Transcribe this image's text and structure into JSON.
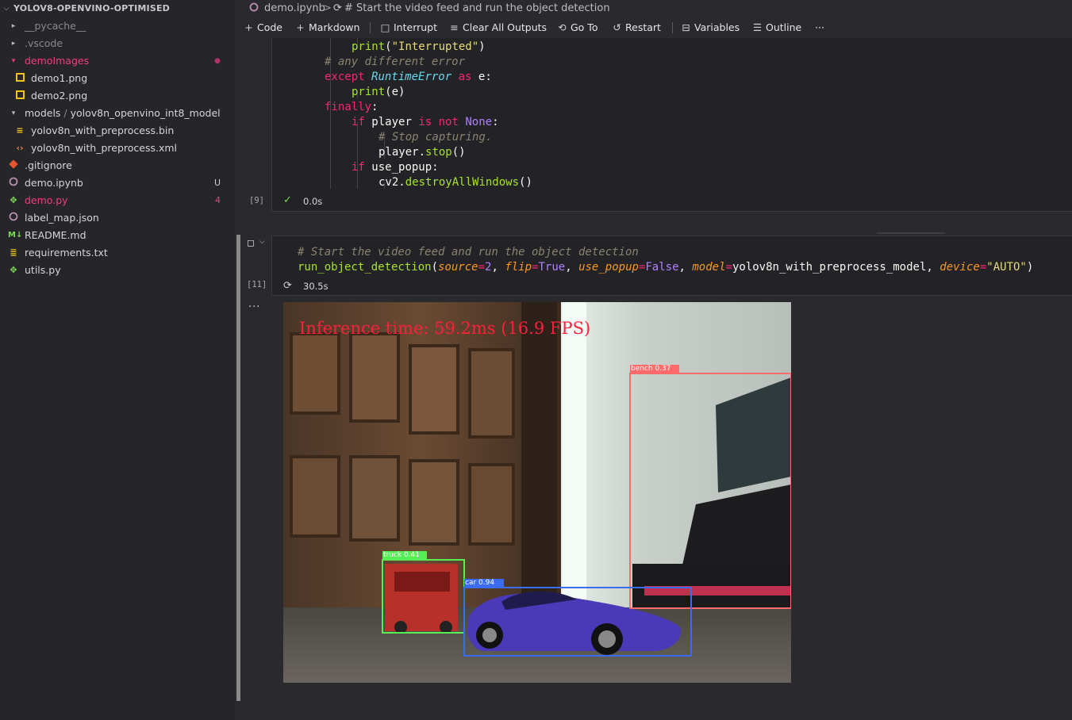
{
  "sidebar": {
    "root": "YOLOV8-OPENVINO-OPTIMISED",
    "items": [
      {
        "label": "__pycache__",
        "icon": "chevron-right-icon",
        "color": "#8a8a8a"
      },
      {
        "label": ".vscode",
        "icon": "chevron-right-icon",
        "color": "#8a8a8a"
      },
      {
        "label": "demoImages",
        "icon": "chevron-down-icon",
        "color": "#e8427c",
        "badge": "●"
      },
      {
        "label": "demo1.png",
        "icon": "image-file-icon",
        "color": "#d6d6d6"
      },
      {
        "label": "demo2.png",
        "icon": "image-file-icon",
        "color": "#d6d6d6"
      },
      {
        "label_a": "models",
        "label_sep": " / ",
        "label_b": "yolov8n_openvino_int8_model",
        "icon": "chevron-down-icon",
        "color": "#d6d6d6"
      },
      {
        "label": "yolov8n_with_preprocess.bin",
        "icon": "binary-file-icon",
        "color": "#d6d6d6"
      },
      {
        "label": "yolov8n_with_preprocess.xml",
        "icon": "xml-file-icon",
        "color": "#d6d6d6"
      },
      {
        "label": ".gitignore",
        "icon": "git-icon",
        "color": "#d6d6d6"
      },
      {
        "label": "demo.ipynb",
        "icon": "jupyter-icon",
        "color": "#d6d6d6",
        "badge": "U"
      },
      {
        "label": "demo.py",
        "icon": "python-icon",
        "color": "#e8427c",
        "badge": "4"
      },
      {
        "label": "label_map.json",
        "icon": "json-icon",
        "color": "#d6d6d6"
      },
      {
        "label": "README.md",
        "icon": "markdown-icon",
        "color": "#d6d6d6"
      },
      {
        "label": "requirements.txt",
        "icon": "text-file-icon",
        "color": "#d6d6d6"
      },
      {
        "label": "utils.py",
        "icon": "python-icon",
        "color": "#d6d6d6"
      }
    ]
  },
  "breadcrumb": {
    "file": "demo.ipynb",
    "sep": ">",
    "cell": "# Start the video feed and run the object detection"
  },
  "toolbar": {
    "code": "Code",
    "markdown": "Markdown",
    "interrupt": "Interrupt",
    "clear_outputs": "Clear All Outputs",
    "goto": "Go To",
    "restart": "Restart",
    "variables": "Variables",
    "outline": "Outline",
    "more": "···"
  },
  "cell9": {
    "exec_count": "[9]",
    "status": "0.0s",
    "lines": {
      "l1_fn": "print",
      "l1_str": "\"Interrupted\"",
      "l2_cm": "# any different error",
      "l3_kw": "except",
      "l3_cls": "RuntimeError",
      "l3_as": "as",
      "l3_var": "e",
      "l4_fn": "print",
      "l4_var": "e",
      "l5_kw": "finally",
      "l6_if": "if",
      "l6_var": "player",
      "l6_is": "is",
      "l6_not": "not",
      "l6_none": "None",
      "l7_cm": "# Stop capturing.",
      "l8_var": "player",
      "l8_fn": "stop",
      "l9_if": "if",
      "l9_var": "use_popup",
      "l10_var": "cv2",
      "l10_fn": "destroyAllWindows"
    }
  },
  "cell11": {
    "exec_count": "[11]",
    "status": "30.5s",
    "comment": "# Start the video feed and run the object detection",
    "fn": "run_object_detection",
    "p1": "source",
    "v1": "2",
    "p2": "flip",
    "v2": "True",
    "p3": "use_popup",
    "v3": "False",
    "p4": "model",
    "v4": "yolov8n_with_preprocess_model",
    "p5": "device",
    "v5": "\"AUTO\"",
    "output_menu": "···"
  },
  "frame": {
    "inference_text": "Inference time: 59.2ms (16.9 FPS)",
    "detections": [
      {
        "label": "bench 0.37",
        "color": "#ff6b6b"
      },
      {
        "label": "truck 0.41",
        "color": "#55ee55"
      },
      {
        "label": "car 0.94",
        "color": "#3b6cf0"
      }
    ]
  },
  "colors": {
    "accent_red": "#e8427c",
    "bg_editor": "#2a2a2e",
    "bg_sidebar": "#25252a"
  }
}
